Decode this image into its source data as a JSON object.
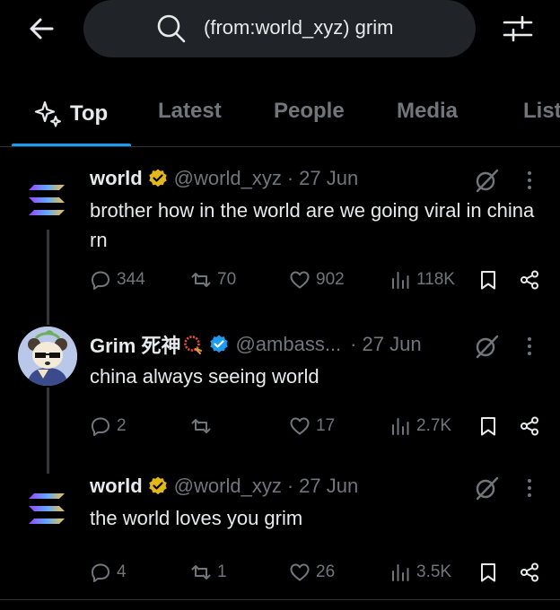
{
  "search": {
    "query": "(from:world_xyz) grim"
  },
  "tabs": [
    {
      "label": "Top",
      "active": true
    },
    {
      "label": "Latest",
      "active": false
    },
    {
      "label": "People",
      "active": false
    },
    {
      "label": "Media",
      "active": false
    },
    {
      "label": "List",
      "active": false
    }
  ],
  "colors": {
    "accent": "#1d9bf0",
    "gold_badge": "#e2b719",
    "blue_badge": "#1d9bf0",
    "muted": "#71767b",
    "background": "#000000"
  },
  "tweets": [
    {
      "name": "world",
      "badge": "gold-verified-badge",
      "handle": "@world_xyz",
      "sep": "·",
      "date": "27 Jun",
      "text": "brother how in the world are we going viral in china rn",
      "replies": "344",
      "retweets": "70",
      "likes": "902",
      "views": "118K"
    },
    {
      "name": "Grim 死神",
      "emoji": "prayer-beads-emoji",
      "badge": "blue-verified-badge",
      "handle": "@ambass...",
      "sep": "·",
      "date": "27 Jun",
      "text": "china always seeing world",
      "replies": "2",
      "retweets": "",
      "likes": "17",
      "views": "2.7K"
    },
    {
      "name": "world",
      "badge": "gold-verified-badge",
      "handle": "@world_xyz",
      "sep": "·",
      "date": "27 Jun",
      "text": "the world loves you grim",
      "replies": "4",
      "retweets": "1",
      "likes": "26",
      "views": "3.5K"
    }
  ]
}
